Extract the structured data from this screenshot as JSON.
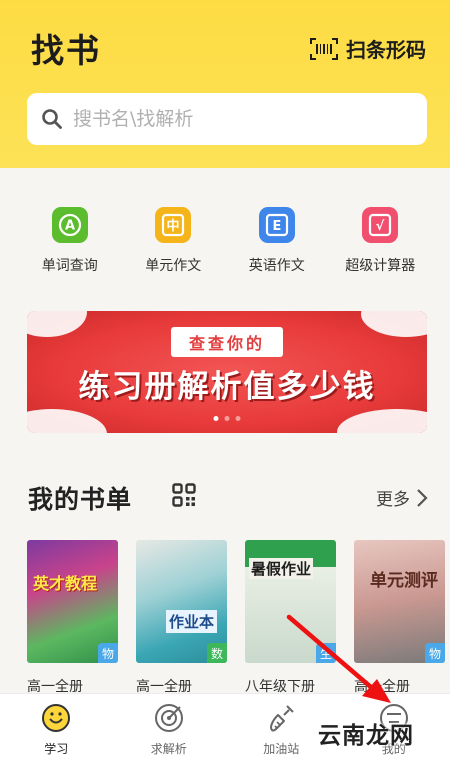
{
  "header": {
    "title": "找书",
    "scan_label": "扫条形码"
  },
  "search": {
    "placeholder": "搜书名\\找解析"
  },
  "tools": [
    {
      "label": "单词查询",
      "icon": "a-icon",
      "color": "#5bbd2e",
      "glyph": "A"
    },
    {
      "label": "单元作文",
      "icon": "zhong-icon",
      "color": "#f4b41a",
      "glyph": "中"
    },
    {
      "label": "英语作文",
      "icon": "e-icon",
      "color": "#3f86ea",
      "glyph": "E"
    },
    {
      "label": "超级计算器",
      "icon": "calculator-icon",
      "color": "#f0506e",
      "glyph": "√"
    }
  ],
  "banner": {
    "tag": "查查你的",
    "main": "练习册解析值多少钱"
  },
  "booklist": {
    "title": "我的书单",
    "more": "更多",
    "books": [
      {
        "caption": "高一全册",
        "badge": "物",
        "badge_color": "#4aa8e8",
        "cover_text": "英才教程"
      },
      {
        "caption": "高一全册",
        "badge": "数",
        "badge_color": "#3cb85a",
        "cover_text": "作业本"
      },
      {
        "caption": "八年级下册",
        "badge": "生",
        "badge_color": "#4aa8e8",
        "cover_text": "暑假作业"
      },
      {
        "caption": "高一全册",
        "badge": "物",
        "badge_color": "#4aa8e8",
        "cover_text": "单元测评"
      }
    ]
  },
  "tabbar": [
    {
      "label": "学习",
      "icon": "study-icon"
    },
    {
      "label": "求解析",
      "icon": "target-icon"
    },
    {
      "label": "加油站",
      "icon": "carrot-icon"
    },
    {
      "label": "我的",
      "icon": "profile-icon"
    }
  ],
  "watermark": "云南龙网"
}
